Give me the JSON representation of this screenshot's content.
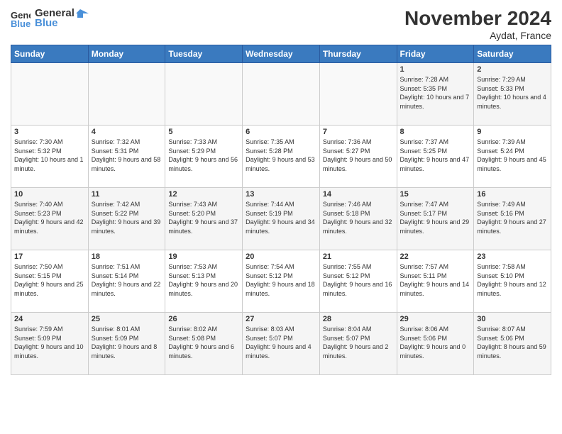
{
  "header": {
    "logo_line1": "General",
    "logo_line2": "Blue",
    "month": "November 2024",
    "location": "Aydat, France"
  },
  "weekdays": [
    "Sunday",
    "Monday",
    "Tuesday",
    "Wednesday",
    "Thursday",
    "Friday",
    "Saturday"
  ],
  "weeks": [
    [
      {
        "day": "",
        "info": ""
      },
      {
        "day": "",
        "info": ""
      },
      {
        "day": "",
        "info": ""
      },
      {
        "day": "",
        "info": ""
      },
      {
        "day": "",
        "info": ""
      },
      {
        "day": "1",
        "info": "Sunrise: 7:28 AM\nSunset: 5:35 PM\nDaylight: 10 hours and 7 minutes."
      },
      {
        "day": "2",
        "info": "Sunrise: 7:29 AM\nSunset: 5:33 PM\nDaylight: 10 hours and 4 minutes."
      }
    ],
    [
      {
        "day": "3",
        "info": "Sunrise: 7:30 AM\nSunset: 5:32 PM\nDaylight: 10 hours and 1 minute."
      },
      {
        "day": "4",
        "info": "Sunrise: 7:32 AM\nSunset: 5:31 PM\nDaylight: 9 hours and 58 minutes."
      },
      {
        "day": "5",
        "info": "Sunrise: 7:33 AM\nSunset: 5:29 PM\nDaylight: 9 hours and 56 minutes."
      },
      {
        "day": "6",
        "info": "Sunrise: 7:35 AM\nSunset: 5:28 PM\nDaylight: 9 hours and 53 minutes."
      },
      {
        "day": "7",
        "info": "Sunrise: 7:36 AM\nSunset: 5:27 PM\nDaylight: 9 hours and 50 minutes."
      },
      {
        "day": "8",
        "info": "Sunrise: 7:37 AM\nSunset: 5:25 PM\nDaylight: 9 hours and 47 minutes."
      },
      {
        "day": "9",
        "info": "Sunrise: 7:39 AM\nSunset: 5:24 PM\nDaylight: 9 hours and 45 minutes."
      }
    ],
    [
      {
        "day": "10",
        "info": "Sunrise: 7:40 AM\nSunset: 5:23 PM\nDaylight: 9 hours and 42 minutes."
      },
      {
        "day": "11",
        "info": "Sunrise: 7:42 AM\nSunset: 5:22 PM\nDaylight: 9 hours and 39 minutes."
      },
      {
        "day": "12",
        "info": "Sunrise: 7:43 AM\nSunset: 5:20 PM\nDaylight: 9 hours and 37 minutes."
      },
      {
        "day": "13",
        "info": "Sunrise: 7:44 AM\nSunset: 5:19 PM\nDaylight: 9 hours and 34 minutes."
      },
      {
        "day": "14",
        "info": "Sunrise: 7:46 AM\nSunset: 5:18 PM\nDaylight: 9 hours and 32 minutes."
      },
      {
        "day": "15",
        "info": "Sunrise: 7:47 AM\nSunset: 5:17 PM\nDaylight: 9 hours and 29 minutes."
      },
      {
        "day": "16",
        "info": "Sunrise: 7:49 AM\nSunset: 5:16 PM\nDaylight: 9 hours and 27 minutes."
      }
    ],
    [
      {
        "day": "17",
        "info": "Sunrise: 7:50 AM\nSunset: 5:15 PM\nDaylight: 9 hours and 25 minutes."
      },
      {
        "day": "18",
        "info": "Sunrise: 7:51 AM\nSunset: 5:14 PM\nDaylight: 9 hours and 22 minutes."
      },
      {
        "day": "19",
        "info": "Sunrise: 7:53 AM\nSunset: 5:13 PM\nDaylight: 9 hours and 20 minutes."
      },
      {
        "day": "20",
        "info": "Sunrise: 7:54 AM\nSunset: 5:12 PM\nDaylight: 9 hours and 18 minutes."
      },
      {
        "day": "21",
        "info": "Sunrise: 7:55 AM\nSunset: 5:12 PM\nDaylight: 9 hours and 16 minutes."
      },
      {
        "day": "22",
        "info": "Sunrise: 7:57 AM\nSunset: 5:11 PM\nDaylight: 9 hours and 14 minutes."
      },
      {
        "day": "23",
        "info": "Sunrise: 7:58 AM\nSunset: 5:10 PM\nDaylight: 9 hours and 12 minutes."
      }
    ],
    [
      {
        "day": "24",
        "info": "Sunrise: 7:59 AM\nSunset: 5:09 PM\nDaylight: 9 hours and 10 minutes."
      },
      {
        "day": "25",
        "info": "Sunrise: 8:01 AM\nSunset: 5:09 PM\nDaylight: 9 hours and 8 minutes."
      },
      {
        "day": "26",
        "info": "Sunrise: 8:02 AM\nSunset: 5:08 PM\nDaylight: 9 hours and 6 minutes."
      },
      {
        "day": "27",
        "info": "Sunrise: 8:03 AM\nSunset: 5:07 PM\nDaylight: 9 hours and 4 minutes."
      },
      {
        "day": "28",
        "info": "Sunrise: 8:04 AM\nSunset: 5:07 PM\nDaylight: 9 hours and 2 minutes."
      },
      {
        "day": "29",
        "info": "Sunrise: 8:06 AM\nSunset: 5:06 PM\nDaylight: 9 hours and 0 minutes."
      },
      {
        "day": "30",
        "info": "Sunrise: 8:07 AM\nSunset: 5:06 PM\nDaylight: 8 hours and 59 minutes."
      }
    ]
  ]
}
